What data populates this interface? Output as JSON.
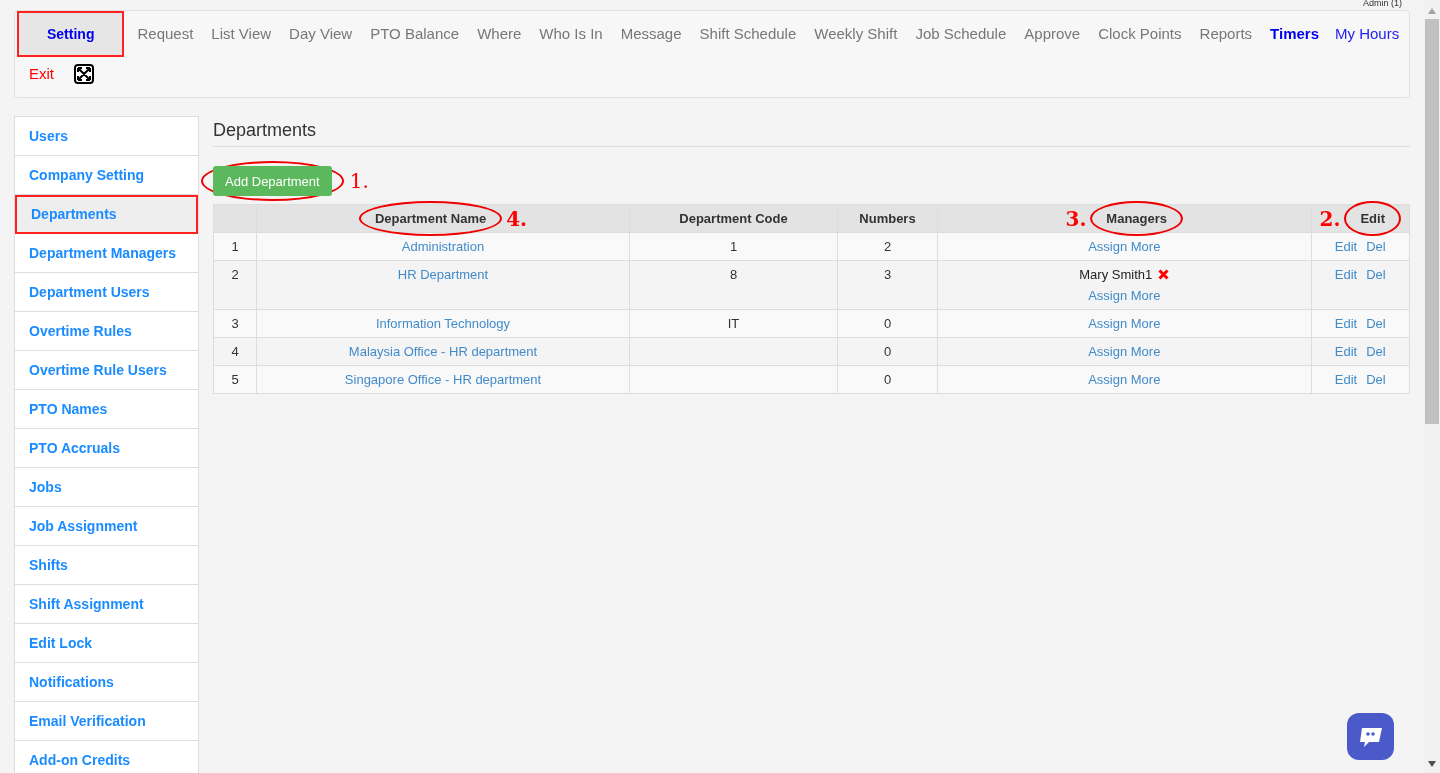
{
  "account": {
    "label": "Admin (1)"
  },
  "nav": [
    {
      "label": "Setting",
      "kind": "tab",
      "selected": true
    },
    {
      "label": "Request",
      "kind": "tab",
      "selected": false
    },
    {
      "label": "List View",
      "kind": "tab",
      "selected": false
    },
    {
      "label": "Day View",
      "kind": "tab",
      "selected": false
    },
    {
      "label": "PTO Balance",
      "kind": "tab",
      "selected": false
    },
    {
      "label": "Where",
      "kind": "tab",
      "selected": false
    },
    {
      "label": "Who Is In",
      "kind": "tab",
      "selected": false
    },
    {
      "label": "Message",
      "kind": "tab",
      "selected": false
    },
    {
      "label": "Shift Schedule",
      "kind": "tab",
      "selected": false
    },
    {
      "label": "Weekly Shift",
      "kind": "tab",
      "selected": false
    },
    {
      "label": "Job Schedule",
      "kind": "tab",
      "selected": false
    },
    {
      "label": "Approve",
      "kind": "tab",
      "selected": false
    },
    {
      "label": "Clock Points",
      "kind": "tab",
      "selected": false
    },
    {
      "label": "Reports",
      "kind": "tab",
      "selected": false
    },
    {
      "label": "Timers",
      "kind": "highlight"
    },
    {
      "label": "My Hours",
      "kind": "link"
    },
    {
      "label": "Exit",
      "kind": "danger"
    },
    {
      "kind": "fullscreen"
    }
  ],
  "sidebar": {
    "items": [
      {
        "label": "Users",
        "selected": false
      },
      {
        "label": "Company Setting",
        "selected": false
      },
      {
        "label": "Departments",
        "selected": true
      },
      {
        "label": "Department Managers",
        "selected": false
      },
      {
        "label": "Department Users",
        "selected": false
      },
      {
        "label": "Overtime Rules",
        "selected": false
      },
      {
        "label": "Overtime Rule Users",
        "selected": false
      },
      {
        "label": "PTO Names",
        "selected": false
      },
      {
        "label": "PTO Accruals",
        "selected": false
      },
      {
        "label": "Jobs",
        "selected": false
      },
      {
        "label": "Job Assignment",
        "selected": false
      },
      {
        "label": "Shifts",
        "selected": false
      },
      {
        "label": "Shift Assignment",
        "selected": false
      },
      {
        "label": "Edit Lock",
        "selected": false
      },
      {
        "label": "Notifications",
        "selected": false
      },
      {
        "label": "Email Verification",
        "selected": false
      },
      {
        "label": "Add-on Credits",
        "selected": false
      }
    ]
  },
  "page": {
    "title": "Departments"
  },
  "add_button": {
    "label": "Add Department",
    "callout": "1."
  },
  "table": {
    "columns": [
      {},
      {
        "label": "Department Name",
        "callout_after": "4."
      },
      {
        "label": "Department Code"
      },
      {
        "label": "Numbers"
      },
      {
        "label": "Managers",
        "callout_before": "3."
      },
      {
        "label": "Edit",
        "callout_before": "2."
      }
    ],
    "rows": [
      {
        "index": "1",
        "name": "Administration",
        "code": "1",
        "numbers": "2",
        "managers": [],
        "assign": "Assign More",
        "edit": "Edit",
        "delete": "Del"
      },
      {
        "index": "2",
        "name": "HR Department",
        "code": "8",
        "numbers": "3",
        "managers": [
          "Mary Smith1"
        ],
        "assign": "Assign More",
        "edit": "Edit",
        "delete": "Del"
      },
      {
        "index": "3",
        "name": "Information Technology",
        "code": "IT",
        "numbers": "0",
        "managers": [],
        "assign": "Assign More",
        "edit": "Edit",
        "delete": "Del"
      },
      {
        "index": "4",
        "name": "Malaysia Office - HR department",
        "code": "",
        "numbers": "0",
        "managers": [],
        "assign": "Assign More",
        "edit": "Edit",
        "delete": "Del"
      },
      {
        "index": "5",
        "name": "Singapore Office - HR department",
        "code": "",
        "numbers": "0",
        "managers": [],
        "assign": "Assign More",
        "edit": "Edit",
        "delete": "Del"
      }
    ]
  }
}
